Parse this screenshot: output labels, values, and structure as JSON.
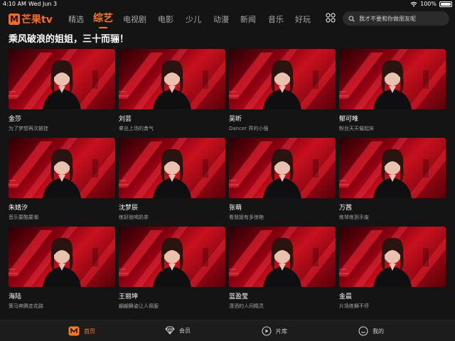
{
  "status_bar": {
    "time": "4:10 AM",
    "date": "Wed Jun 3",
    "battery": "100%"
  },
  "logo": {
    "mark": "M",
    "text": "芒果tv"
  },
  "nav": {
    "tabs": [
      {
        "label": "精选",
        "active": false
      },
      {
        "label": "综艺",
        "active": true
      },
      {
        "label": "电视剧",
        "active": false
      },
      {
        "label": "电影",
        "active": false
      },
      {
        "label": "少儿",
        "active": false
      },
      {
        "label": "动漫",
        "active": false
      },
      {
        "label": "新闻",
        "active": false
      },
      {
        "label": "音乐",
        "active": false
      },
      {
        "label": "好玩",
        "active": false
      }
    ],
    "search_text": "我才不要和你做朋友呢"
  },
  "page_title": "乘风破浪的姐姐，三十而骊！",
  "cards": [
    {
      "name": "金莎",
      "subtitle": "为了梦想再次披挂"
    },
    {
      "name": "刘芸",
      "subtitle": "拿出上场的勇气"
    },
    {
      "name": "吴昕",
      "subtitle": "Dancer 界的小强"
    },
    {
      "name": "郁可唯",
      "subtitle": "粉丝天天催起床"
    },
    {
      "name": "朱婧汐",
      "subtitle": "音乐要酷要潮"
    },
    {
      "name": "沈梦辰",
      "subtitle": "练好就喝奶茶"
    },
    {
      "name": "张萌",
      "subtitle": "看我姐有多惊艳"
    },
    {
      "name": "万茜",
      "subtitle": "练琴练到手废"
    },
    {
      "name": "海陆",
      "subtitle": "策马奔腾走花路"
    },
    {
      "name": "王丽坤",
      "subtitle": "翩翩舞姿让人佩服"
    },
    {
      "name": "蓝盈莹",
      "subtitle": "潇洒的人间精灵"
    },
    {
      "name": "金晨",
      "subtitle": "片场练舞不停"
    }
  ],
  "tabbar": {
    "items": [
      {
        "label": "首页",
        "icon": "mango-home-icon",
        "active": true
      },
      {
        "label": "会员",
        "icon": "diamond-icon",
        "active": false
      },
      {
        "label": "片库",
        "icon": "play-circle-icon",
        "active": false
      },
      {
        "label": "我的",
        "icon": "smiley-icon",
        "active": false
      }
    ]
  },
  "colors": {
    "accent": "#ff7a1a",
    "background": "#141414",
    "thumb_red": "#c8101e"
  }
}
